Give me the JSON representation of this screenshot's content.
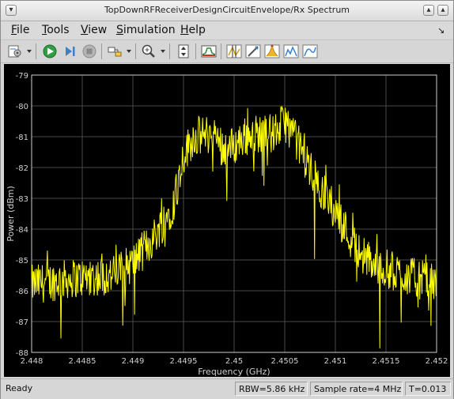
{
  "window": {
    "title": "TopDownRFReceiverDesignCircuitEnvelope/Rx Spectrum"
  },
  "menu": [
    {
      "label": "File",
      "key": "F",
      "rest": "ile"
    },
    {
      "label": "Tools",
      "key": "T",
      "rest": "ools"
    },
    {
      "label": "View",
      "key": "V",
      "rest": "iew"
    },
    {
      "label": "Simulation",
      "key": "S",
      "rest": "imulation"
    },
    {
      "label": "Help",
      "key": "H",
      "rest": "elp"
    }
  ],
  "toolbar": {
    "icons": [
      "settings-icon",
      "run-icon",
      "step-forward-icon",
      "stop-icon",
      "highlight-simulink-block-icon",
      "zoom-in-icon",
      "scale-axes-icon",
      "spectrum-settings-icon",
      "cursor-measurements-icon",
      "signal-statistics-icon",
      "peak-finder-icon",
      "channel-measurements-icon",
      "distortion-measurements-icon"
    ]
  },
  "chart_data": {
    "type": "line",
    "title": "",
    "xlabel": "Frequency (GHz)",
    "ylabel": "Power (dBm)",
    "xlim": [
      2.448,
      2.452
    ],
    "ylim": [
      -88,
      -79
    ],
    "xticks": [
      "2.448",
      "2.4485",
      "2.449",
      "2.4495",
      "2.45",
      "2.4505",
      "2.451",
      "2.4515",
      "2.452"
    ],
    "yticks": [
      "-79",
      "-80",
      "-81",
      "-82",
      "-83",
      "-84",
      "-85",
      "-86",
      "-87",
      "-88"
    ],
    "grid": true,
    "background": "#000000",
    "line_color": "#ffff00",
    "series": [
      {
        "envelope_x": [
          2.448,
          2.4484,
          2.4488,
          2.449,
          2.4492,
          2.4494,
          2.4495,
          2.4496,
          2.4498,
          2.4499,
          2.45,
          2.4501,
          2.4502,
          2.4504,
          2.4505,
          2.4506,
          2.4508,
          2.451,
          2.4512,
          2.4514,
          2.4516,
          2.4518,
          2.452
        ],
        "envelope_y": [
          -85.8,
          -85.6,
          -85.5,
          -85.1,
          -84.3,
          -83.2,
          -81.6,
          -81.0,
          -80.9,
          -81.4,
          -81.3,
          -81.0,
          -80.9,
          -80.9,
          -80.5,
          -81.0,
          -82.4,
          -83.4,
          -84.6,
          -85.2,
          -85.4,
          -85.6,
          -85.8
        ]
      }
    ]
  },
  "status": {
    "state": "Ready",
    "rbw": "RBW=5.86 kHz",
    "sample_rate": "Sample rate=4 MHz",
    "time": "T=0.013"
  }
}
